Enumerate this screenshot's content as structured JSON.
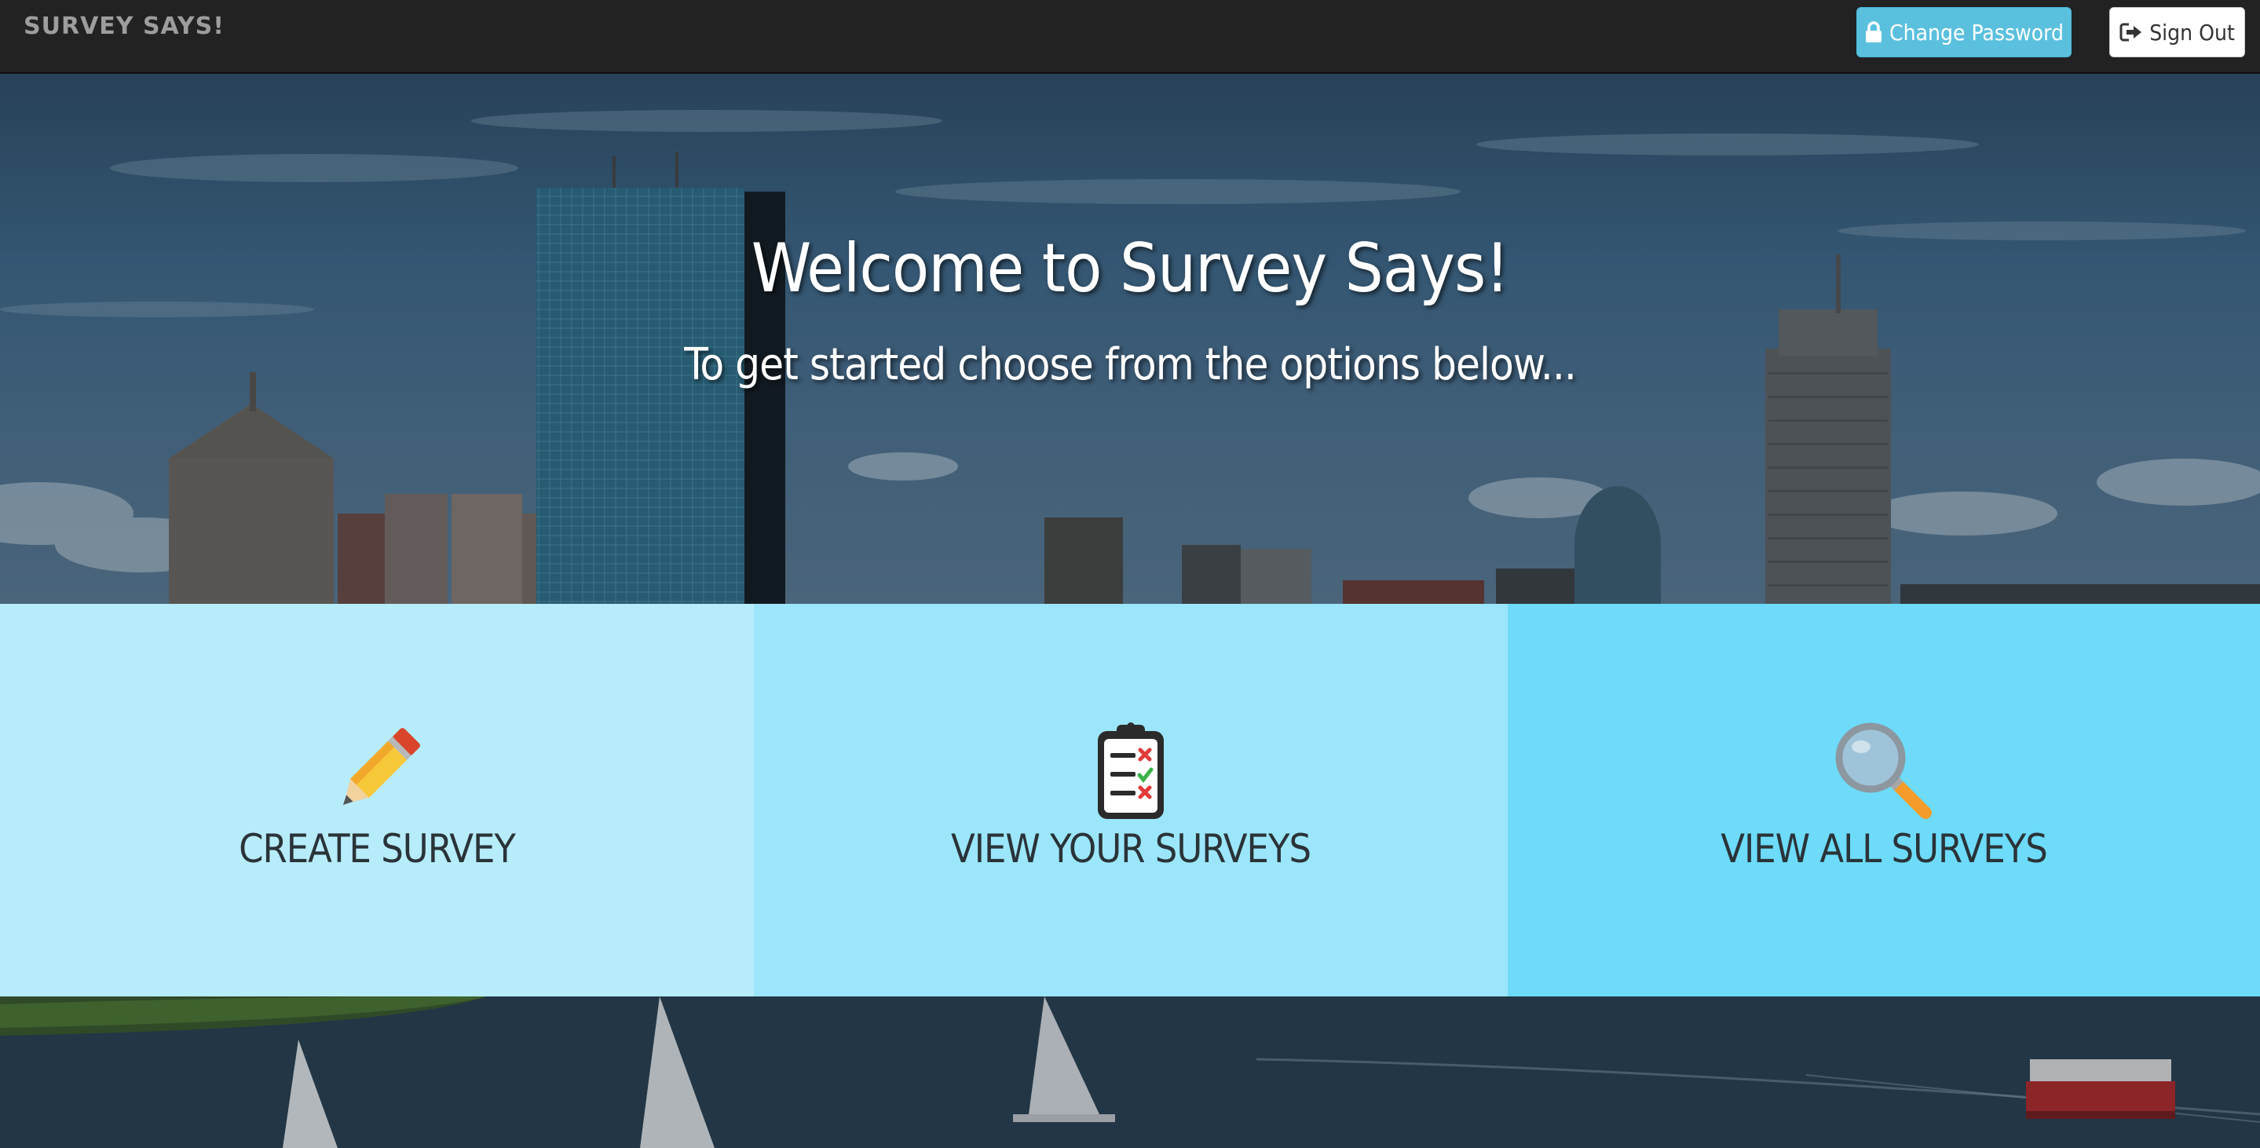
{
  "navbar": {
    "brand": "SURVEY SAYS!",
    "change_password_label": "Change Password",
    "sign_out_label": "Sign Out"
  },
  "hero": {
    "title": "Welcome to Survey Says!",
    "subtitle": "To get started choose from the options below..."
  },
  "options": [
    {
      "label": "CREATE SURVEY",
      "icon": "pencil-icon",
      "color": "#b7ecfb"
    },
    {
      "label": "VIEW YOUR SURVEYS",
      "icon": "clipboard-icon",
      "color": "#9be6fa"
    },
    {
      "label": "VIEW ALL SURVEYS",
      "icon": "magnifying-glass-icon",
      "color": "#6ddbf9"
    }
  ],
  "colors": {
    "navbar": "#222222",
    "change_password_button": "#5bc0de",
    "sign_out_button": "#ffffff"
  }
}
